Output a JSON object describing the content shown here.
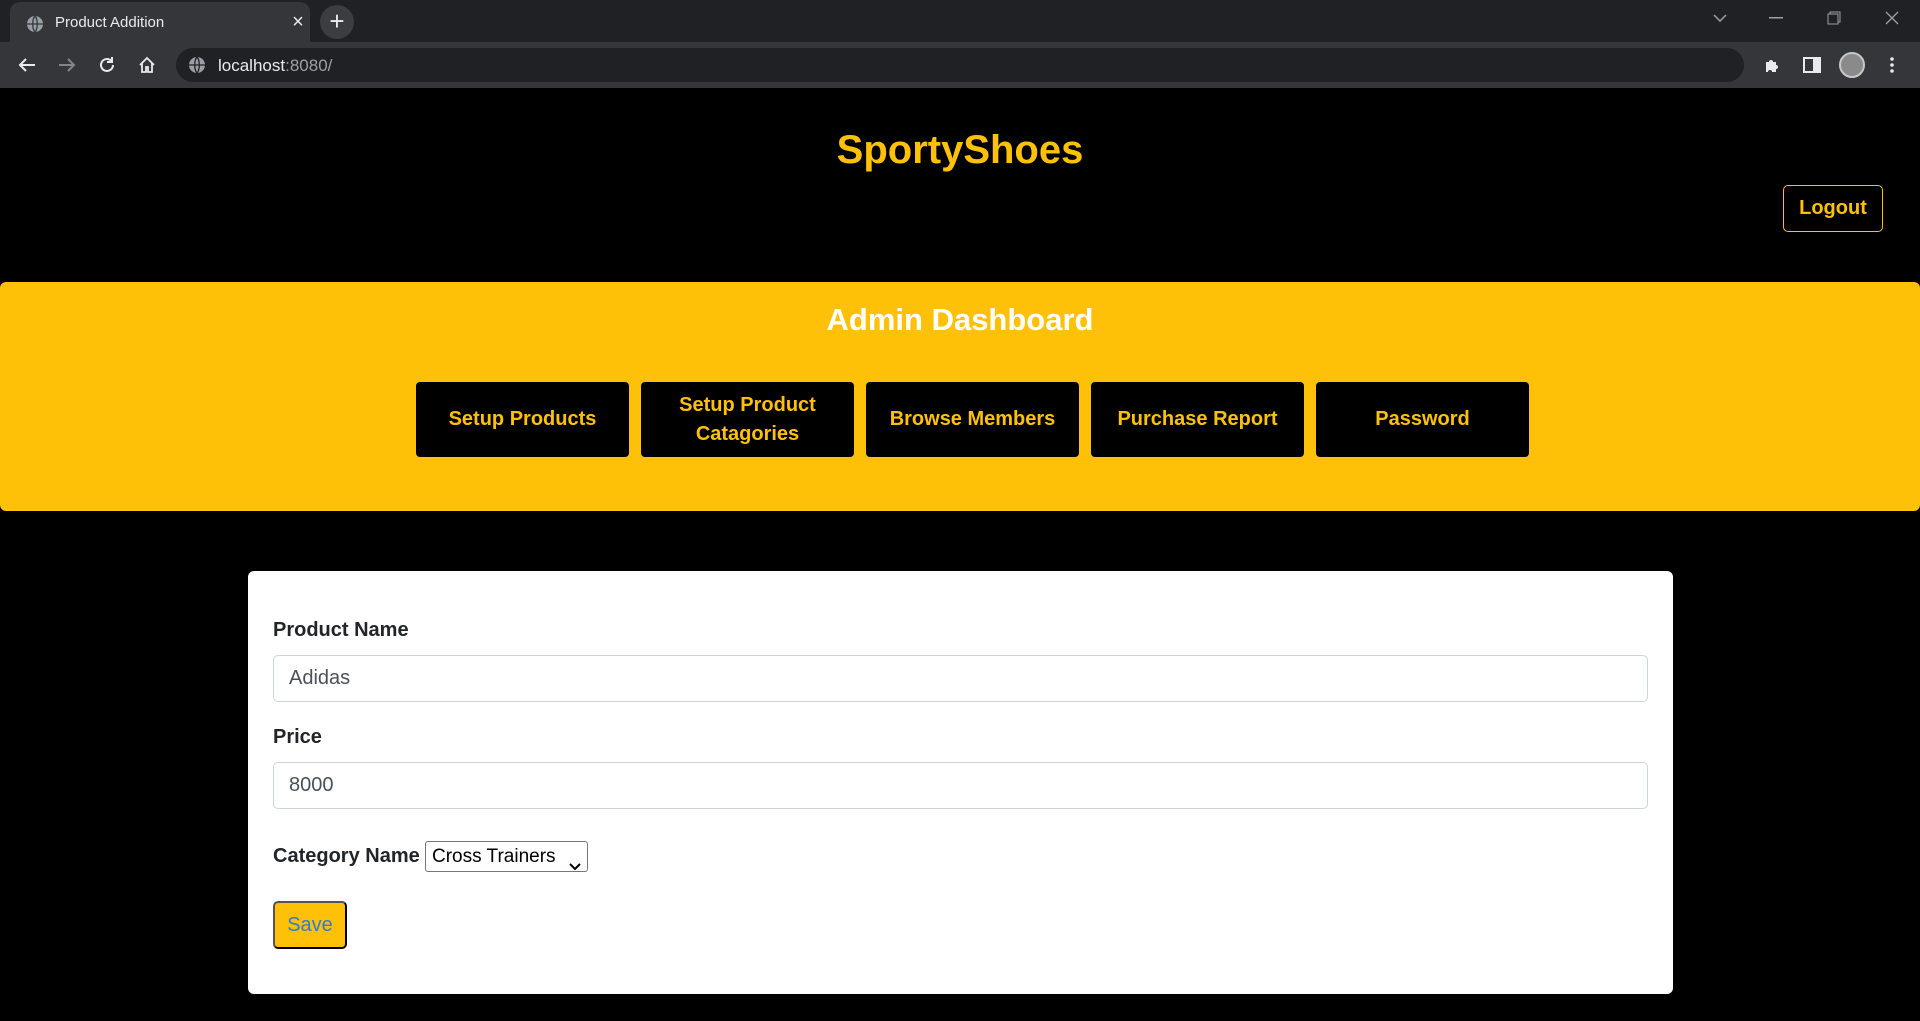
{
  "browser": {
    "tab_title": "Product Addition",
    "url_host": "localhost",
    "url_port": ":8080/"
  },
  "site": {
    "brand": "SportyShoes",
    "logout_label": "Logout"
  },
  "dashboard": {
    "title": "Admin Dashboard",
    "buttons": [
      "Setup Products",
      "Setup Product Catagories",
      "Browse Members",
      "Purchase Report",
      "Password"
    ]
  },
  "form": {
    "product_name_label": "Product Name",
    "product_name_value": "Adidas",
    "price_label": "Price",
    "price_value": "8000",
    "category_label": "Category Name",
    "category_value": "Cross Trainers",
    "save_label": "Save"
  },
  "colors": {
    "accent": "#ffc107",
    "background": "#000000",
    "card": "#ffffff"
  }
}
